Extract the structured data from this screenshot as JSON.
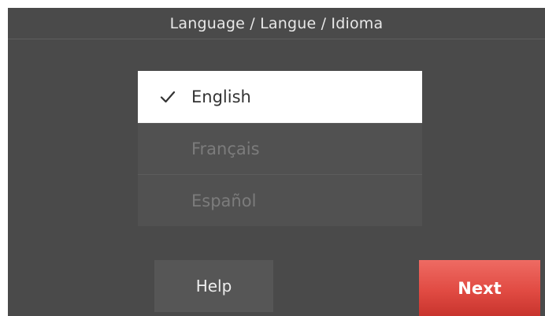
{
  "header": {
    "title": "Language / Langue / Idioma"
  },
  "languages": {
    "items": [
      {
        "label": "English",
        "selected": true
      },
      {
        "label": "Français",
        "selected": false
      },
      {
        "label": "Español",
        "selected": false
      }
    ],
    "check_icon": "checkmark-icon"
  },
  "footer": {
    "help_label": "Help",
    "next_label": "Next"
  },
  "colors": {
    "background": "#4a4a4a",
    "selected_item": "#ffffff",
    "next_button": "#e14b43"
  }
}
